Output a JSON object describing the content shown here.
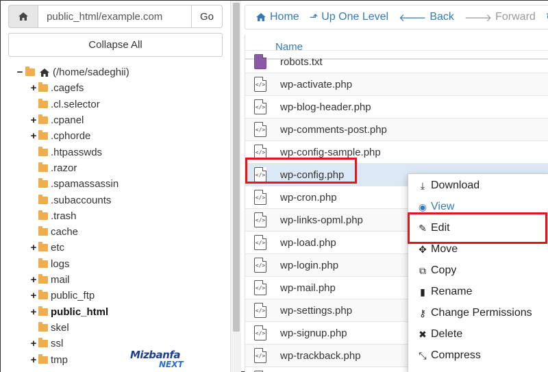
{
  "left_panel": {
    "path_value": "public_html/example.com",
    "go_label": "Go",
    "collapse_label": "Collapse All",
    "tree": [
      {
        "label": "(/home/sadeghii)",
        "toggle": "−",
        "kind": "home",
        "bold": false
      },
      {
        "label": ".cagefs",
        "toggle": "+",
        "kind": "folder",
        "bold": false
      },
      {
        "label": ".cl.selector",
        "toggle": "",
        "kind": "folder",
        "bold": false
      },
      {
        "label": ".cpanel",
        "toggle": "+",
        "kind": "folder",
        "bold": false
      },
      {
        "label": ".cphorde",
        "toggle": "+",
        "kind": "folder",
        "bold": false
      },
      {
        "label": ".htpasswds",
        "toggle": "",
        "kind": "folder",
        "bold": false
      },
      {
        "label": ".razor",
        "toggle": "",
        "kind": "folder",
        "bold": false
      },
      {
        "label": ".spamassassin",
        "toggle": "",
        "kind": "folder",
        "bold": false
      },
      {
        "label": ".subaccounts",
        "toggle": "",
        "kind": "folder",
        "bold": false
      },
      {
        "label": ".trash",
        "toggle": "",
        "kind": "folder",
        "bold": false
      },
      {
        "label": "cache",
        "toggle": "",
        "kind": "folder",
        "bold": false
      },
      {
        "label": "etc",
        "toggle": "+",
        "kind": "folder",
        "bold": false
      },
      {
        "label": "logs",
        "toggle": "",
        "kind": "folder",
        "bold": false
      },
      {
        "label": "mail",
        "toggle": "+",
        "kind": "folder",
        "bold": false
      },
      {
        "label": "public_ftp",
        "toggle": "+",
        "kind": "folder",
        "bold": false
      },
      {
        "label": "public_html",
        "toggle": "+",
        "kind": "folder",
        "bold": true
      },
      {
        "label": "skel",
        "toggle": "",
        "kind": "folder",
        "bold": false
      },
      {
        "label": "ssl",
        "toggle": "+",
        "kind": "folder",
        "bold": false
      },
      {
        "label": "tmp",
        "toggle": "+",
        "kind": "folder",
        "bold": false
      }
    ]
  },
  "toolbar": {
    "home": "Home",
    "up": "Up One Level",
    "back": "Back",
    "forward": "Forward",
    "reload": "R"
  },
  "table": {
    "column_name": "Name",
    "files": [
      {
        "name": "robots.txt",
        "icon": "text-file-icon"
      },
      {
        "name": "wp-activate.php",
        "icon": "php-file-icon"
      },
      {
        "name": "wp-blog-header.php",
        "icon": "php-file-icon"
      },
      {
        "name": "wp-comments-post.php",
        "icon": "php-file-icon"
      },
      {
        "name": "wp-config-sample.php",
        "icon": "php-file-icon"
      },
      {
        "name": "wp-config.php",
        "icon": "php-file-icon",
        "selected": true
      },
      {
        "name": "wp-cron.php",
        "icon": "php-file-icon"
      },
      {
        "name": "wp-links-opml.php",
        "icon": "php-file-icon"
      },
      {
        "name": "wp-load.php",
        "icon": "php-file-icon"
      },
      {
        "name": "wp-login.php",
        "icon": "php-file-icon"
      },
      {
        "name": "wp-mail.php",
        "icon": "php-file-icon"
      },
      {
        "name": "wp-settings.php",
        "icon": "php-file-icon"
      },
      {
        "name": "wp-signup.php",
        "icon": "php-file-icon"
      },
      {
        "name": "wp-trackback.php",
        "icon": "php-file-icon"
      },
      {
        "name": "",
        "icon": "php-file-icon"
      }
    ]
  },
  "context_menu": [
    {
      "label": "Download",
      "icon": "download-icon",
      "glyph": "⤓"
    },
    {
      "label": "View",
      "icon": "eye-icon",
      "glyph": "◉"
    },
    {
      "label": "Edit",
      "icon": "pencil-icon",
      "glyph": "✎"
    },
    {
      "label": "Move",
      "icon": "move-icon",
      "glyph": "✥"
    },
    {
      "label": "Copy",
      "icon": "copy-icon",
      "glyph": "⧉"
    },
    {
      "label": "Rename",
      "icon": "file-icon",
      "glyph": "▮"
    },
    {
      "label": "Change Permissions",
      "icon": "key-icon",
      "glyph": "⚷"
    },
    {
      "label": "Delete",
      "icon": "delete-icon",
      "glyph": "✖"
    },
    {
      "label": "Compress",
      "icon": "compress-icon",
      "glyph": "⤡"
    }
  ],
  "watermark": {
    "line1": "Mizbanfa",
    "line2": "NEXT"
  },
  "colors": {
    "link": "#337ab7",
    "folder": "#f0ad4e",
    "highlight": "#e4161b",
    "selected_row": "#dbe8f5"
  }
}
